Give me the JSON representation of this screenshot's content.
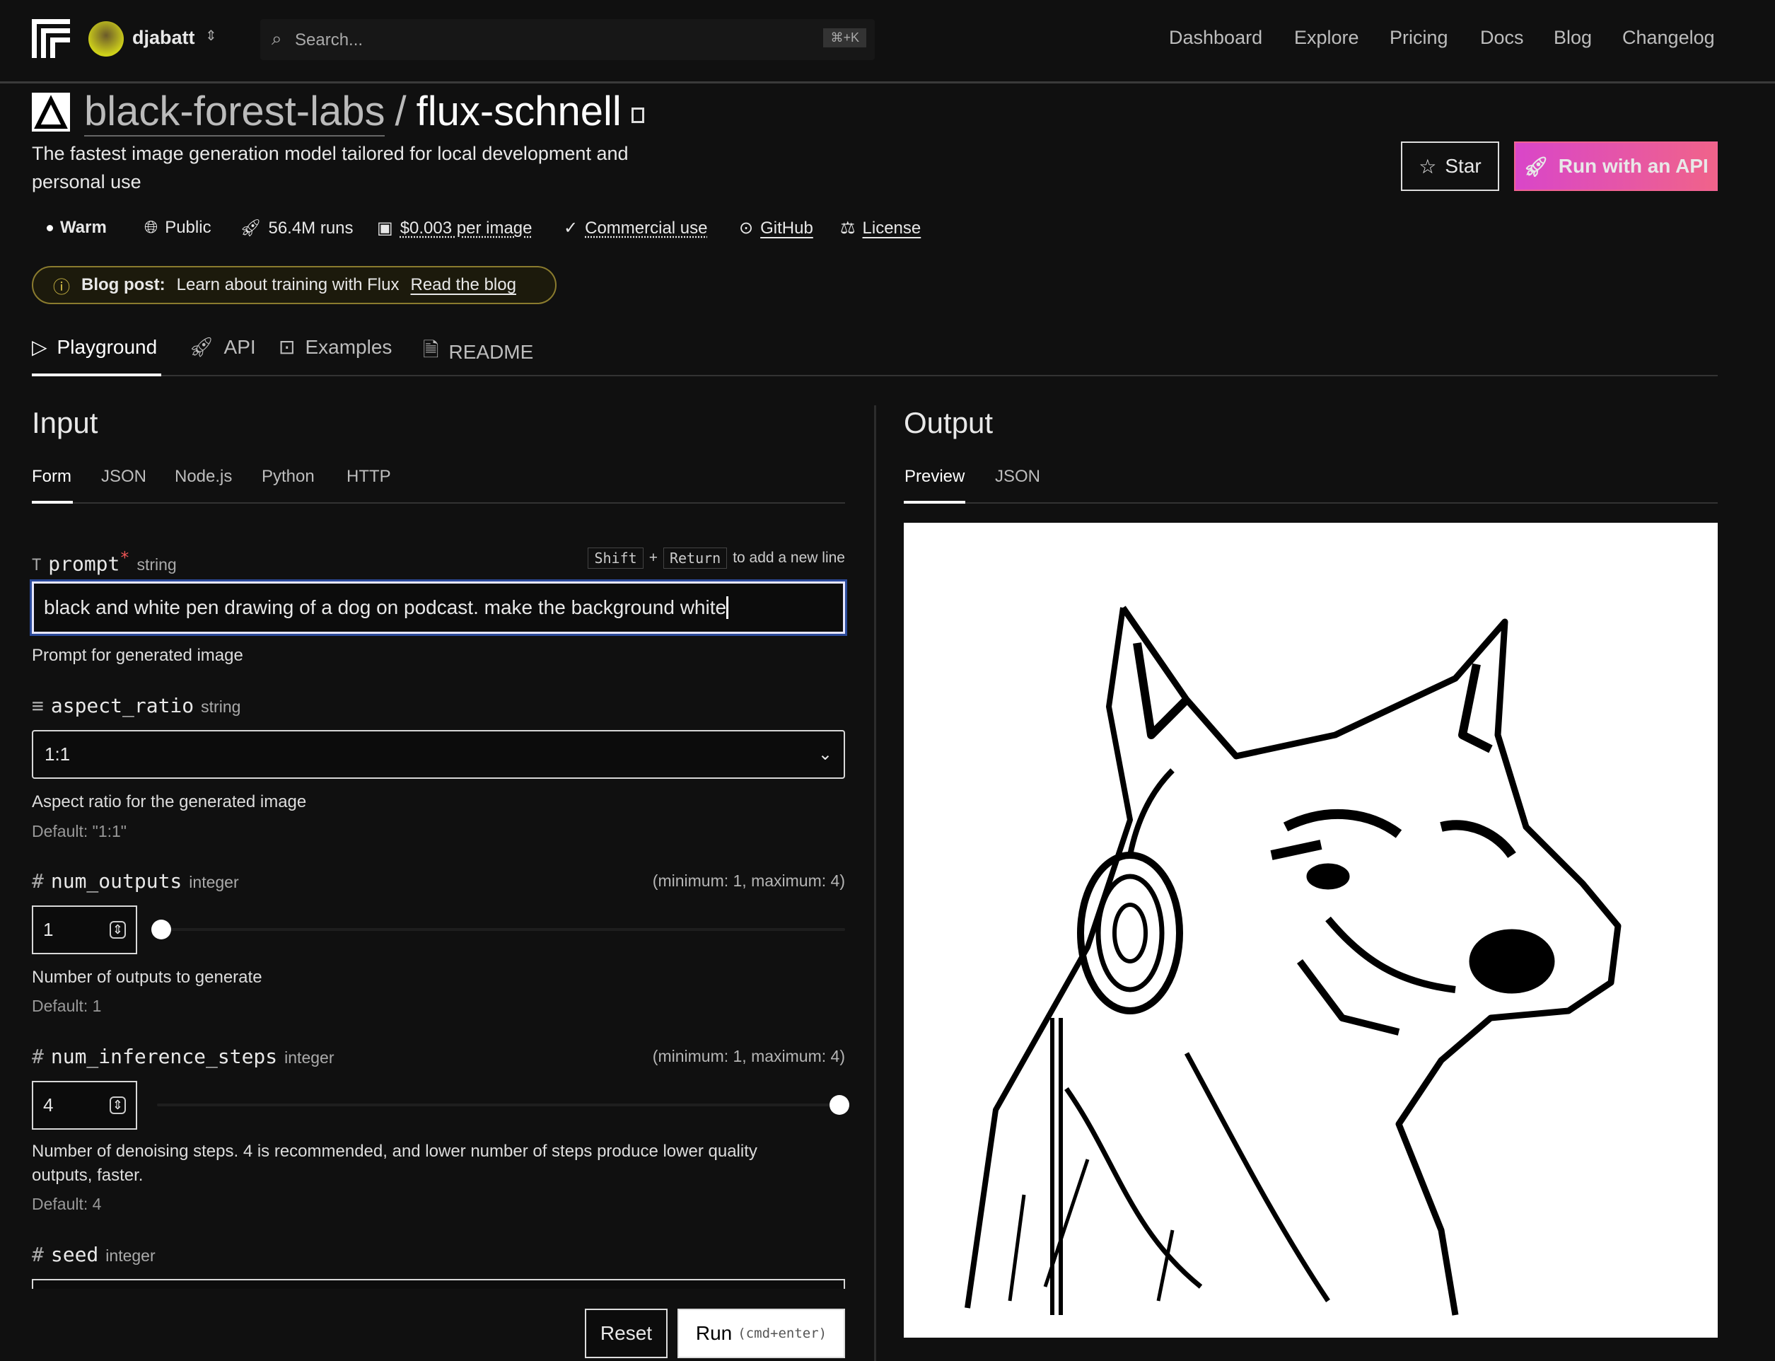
{
  "header": {
    "user": "djabatt",
    "search_placeholder": "Search...",
    "search_shortcut": "⌘+K",
    "nav": [
      "Dashboard",
      "Explore",
      "Pricing",
      "Docs",
      "Blog",
      "Changelog"
    ]
  },
  "model": {
    "owner": "black-forest-labs",
    "separator": "/",
    "name": "flux-schnell",
    "description_line1": "The fastest image generation model tailored for local development and",
    "description_line2": "personal use",
    "star_label": "Star",
    "run_api_label": "Run with an API",
    "meta": {
      "status": "Warm",
      "visibility": "Public",
      "runs": "56.4M runs",
      "price": "$0.003 per image",
      "commercial": "Commercial use",
      "github": "GitHub",
      "license": "License"
    }
  },
  "banner": {
    "label": "Blog post:",
    "text": "Learn about training with Flux",
    "link": "Read the blog"
  },
  "tabs": [
    "Playground",
    "API",
    "Examples",
    "README"
  ],
  "input": {
    "title": "Input",
    "subtabs": [
      "Form",
      "JSON",
      "Node.js",
      "Python",
      "HTTP"
    ],
    "prompt": {
      "name": "prompt",
      "required": "*",
      "type": "string",
      "hint_shift": "Shift",
      "hint_plus": "+",
      "hint_return": "Return",
      "hint_text": "to add a new line",
      "value": "black and white pen drawing of a dog on podcast. make the background white",
      "help": "Prompt for generated image"
    },
    "aspect_ratio": {
      "name": "aspect_ratio",
      "type": "string",
      "value": "1:1",
      "help": "Aspect ratio for the generated image",
      "default": "Default: \"1:1\""
    },
    "num_outputs": {
      "name": "num_outputs",
      "type": "integer",
      "range": "(minimum: 1, maximum: 4)",
      "value": "1",
      "help": "Number of outputs to generate",
      "default": "Default: 1",
      "min": 1,
      "max": 4
    },
    "num_inference_steps": {
      "name": "num_inference_steps",
      "type": "integer",
      "range": "(minimum: 1, maximum: 4)",
      "value": "4",
      "help1": "Number of denoising steps. 4 is recommended, and lower number of steps produce lower quality",
      "help2": "outputs, faster.",
      "default": "Default: 4",
      "min": 1,
      "max": 4
    },
    "seed": {
      "name": "seed",
      "type": "integer"
    },
    "reset_label": "Reset",
    "run_label": "Run",
    "run_shortcut": "(cmd+enter)"
  },
  "output": {
    "title": "Output",
    "subtabs": [
      "Preview",
      "JSON"
    ]
  }
}
